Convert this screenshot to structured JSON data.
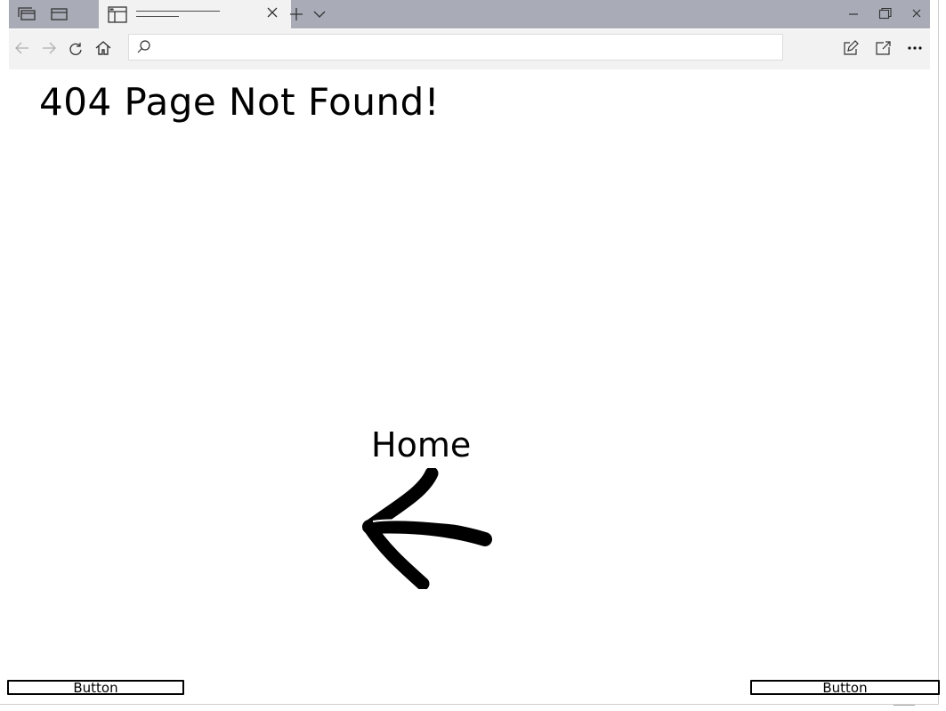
{
  "page": {
    "heading": "404 Page Not Found!",
    "home_label": "Home"
  },
  "buttons": {
    "left_label": "Button",
    "right_label": "Button"
  },
  "browser": {
    "icons": {
      "tab_overview": "tabs-icon",
      "set_aside": "window-icon",
      "favicon": "page-icon",
      "close_tab": "close-icon",
      "new_tab": "plus-icon",
      "tab_list": "chevron-down-icon",
      "minimize": "minimize-icon",
      "restore": "restore-icon",
      "close_window": "close-icon",
      "back": "arrow-left-icon",
      "forward": "arrow-right-icon",
      "refresh": "refresh-icon",
      "home": "home-icon",
      "search": "search-icon",
      "annotate": "pen-icon",
      "share": "share-icon",
      "more": "more-icon"
    },
    "colors": {
      "tab_strip": "#a9acb7",
      "toolbar": "#f2f2f2",
      "page": "#ffffff"
    }
  }
}
